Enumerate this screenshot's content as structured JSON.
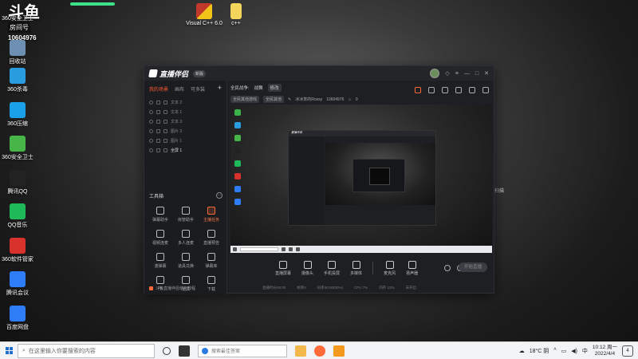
{
  "desktop": {
    "stream_logo": "斗鱼",
    "stream_sub": "房间号",
    "stream_number": "10604976",
    "right_edge_label": "扫描",
    "icons_left": [
      {
        "label": "360安全卫士",
        "color": "#3cb34a"
      },
      {
        "label": "回收站",
        "color": "#6c8fb3"
      },
      {
        "label": "360杀毒",
        "color": "#2a9de0"
      },
      {
        "label": "360压缩",
        "color": "#1aa0e8"
      },
      {
        "label": "360安全卫士",
        "color": "#47b548"
      },
      {
        "label": "腾讯QQ",
        "color": "#222"
      },
      {
        "label": "QQ音乐",
        "color": "#1fb95a"
      },
      {
        "label": "360软件管家",
        "color": "#d9322c"
      },
      {
        "label": "腾讯会议",
        "color": "#2e7cf6"
      },
      {
        "label": "百度网盘",
        "color": "#2f7df6"
      }
    ],
    "icons_top": [
      {
        "label": "Visual C++ 6.0",
        "color": "#c0392b"
      },
      {
        "label": "c++",
        "color": "#f3d55b"
      }
    ]
  },
  "app": {
    "brand": "直播伴侣",
    "version_badge": "新版",
    "tabs": [
      "我的场景",
      "画布",
      "可多装"
    ],
    "tab_add": "+",
    "scenes": [
      "文本 2",
      "文本 1",
      "文本 3",
      "图片 2",
      "图片 1"
    ],
    "main_scene": "全屏 1",
    "tools_title": "工具箱",
    "tools_more": "···",
    "tools": [
      {
        "label": "弹幕助手",
        "hot": false
      },
      {
        "label": "房管助手",
        "hot": false
      },
      {
        "label": "主播任务",
        "hot": true
      },
      {
        "label": "视频连麦",
        "hot": false
      },
      {
        "label": "多人连麦",
        "hot": false
      },
      {
        "label": "直播预告",
        "hot": false
      },
      {
        "label": "波弹幕",
        "hot": false
      },
      {
        "label": "道具兑换",
        "hot": false
      },
      {
        "label": "弹幕库",
        "hot": false
      },
      {
        "label": "PK",
        "hot": false
      },
      {
        "label": "道具",
        "hot": false
      },
      {
        "label": "下载",
        "hot": false
      }
    ],
    "left_footer": "斗鱼直播伴侣使用教程",
    "header": {
      "category_label": "全民战争:",
      "category_value": "战舞",
      "edit_label": "修改",
      "tag1": "全民其他游戏",
      "tag2": "全民其他",
      "room_name": "冰冰茶的Rossy",
      "room_id": "10604976",
      "heat": "0"
    },
    "controls": [
      {
        "label": "直播屏幕"
      },
      {
        "label": "摄像头"
      },
      {
        "label": "手机投屏"
      },
      {
        "label": "多媒体"
      },
      {
        "label": "麦克风"
      },
      {
        "label": "扬声器"
      }
    ],
    "start_button": "开始直播",
    "status": [
      "直播时长00:00",
      "帧率0",
      "码率00:00(00%)",
      "CPU 7%",
      "内存 13%",
      "未开启"
    ]
  },
  "taskbar": {
    "search_placeholder": "在这里输入你要搜索的内容",
    "edge_placeholder": "搜索最佳答案",
    "weather": "18°C 阴",
    "time": "10:12 周一",
    "date": "2022/4/4",
    "notif_count": "4"
  }
}
